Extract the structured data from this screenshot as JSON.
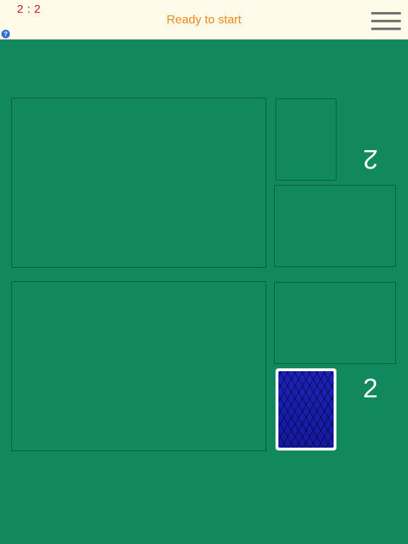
{
  "header": {
    "score": "2 : 2",
    "help_label": "?",
    "status": "Ready to start",
    "menu_icon": "hamburger-menu-icon"
  },
  "opponent": {
    "card_count": "2"
  },
  "player": {
    "card_count": "2"
  },
  "colors": {
    "table": "#12885f",
    "header_bg": "#fffbeb",
    "score": "#d01010",
    "status": "#ef8a1a",
    "card_back": "#1d22b8"
  }
}
